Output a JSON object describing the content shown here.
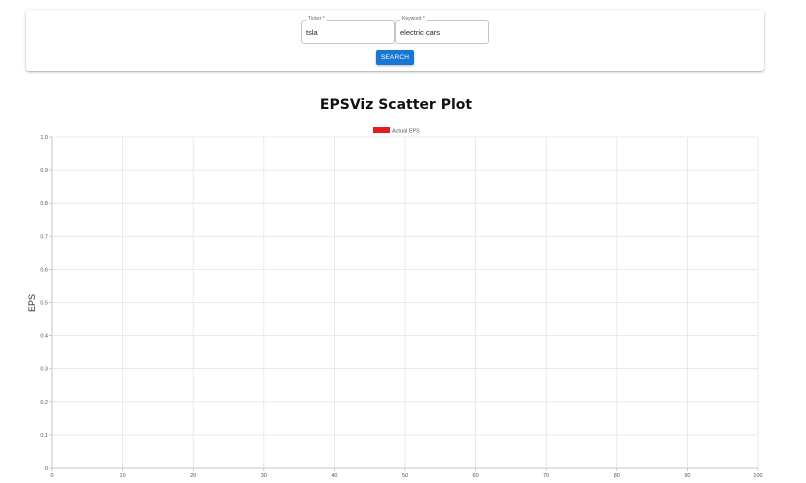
{
  "search": {
    "ticker": {
      "label": "Ticker *",
      "value": "tsla"
    },
    "keyword": {
      "label": "Keyword *",
      "value": "electric cars"
    },
    "button_label": "SEARCH"
  },
  "chart_data": {
    "type": "scatter",
    "title": "EPSViz Scatter Plot",
    "xlabel": "",
    "ylabel": "EPS",
    "xlim": [
      0,
      100
    ],
    "ylim": [
      0,
      1.0
    ],
    "x_ticks": [
      0,
      10,
      20,
      30,
      40,
      50,
      60,
      70,
      80,
      90,
      100
    ],
    "y_ticks": [
      "0",
      "0.1",
      "0.2",
      "0.3",
      "0.4",
      "0.5",
      "0.6",
      "0.7",
      "0.8",
      "0.9",
      "1.0"
    ],
    "grid": true,
    "legend_position": "top-center",
    "series": [
      {
        "name": "Actual EPS",
        "color": "#e8191f",
        "points": []
      }
    ]
  }
}
